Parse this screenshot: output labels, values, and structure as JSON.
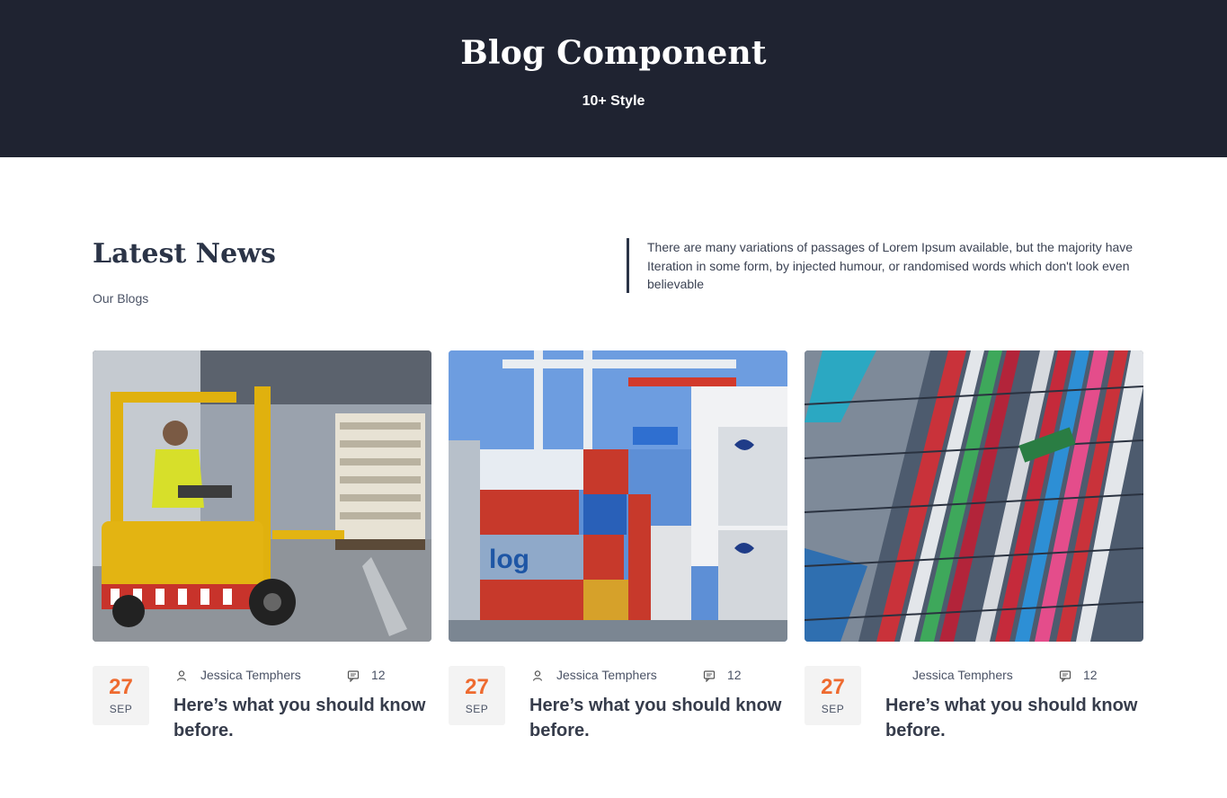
{
  "hero": {
    "title": "Blog Component",
    "subtitle": "10+ Style"
  },
  "section": {
    "title": "Latest News",
    "subtitle": "Our Blogs",
    "intro": "There are many variations of passages of Lorem Ipsum available, but the majority have Iteration in some form, by injected humour, or randomised words which don't look even believable"
  },
  "colors": {
    "hero_bg": "#1f2331",
    "accent": "#ee6a2f",
    "heading": "#2b3447",
    "date_bg": "#f3f3f3"
  },
  "posts": [
    {
      "image": "forklift-warehouse-photo",
      "day": "27",
      "month": "SEP",
      "author": "Jessica Temphers",
      "author_icon": "user-icon",
      "comments": "12",
      "comments_icon": "comment-icon",
      "title": "Here’s what you should know before."
    },
    {
      "image": "shipping-containers-photo",
      "day": "27",
      "month": "SEP",
      "author": "Jessica Temphers",
      "author_icon": "user-icon",
      "comments": "12",
      "comments_icon": "comment-icon",
      "title": "Here’s what you should know before."
    },
    {
      "image": "aerial-container-port-photo",
      "day": "27",
      "month": "SEP",
      "author": "Jessica Temphers",
      "author_icon": "",
      "comments": "12",
      "comments_icon": "comment-icon",
      "title": "Here’s what you should know before."
    }
  ]
}
